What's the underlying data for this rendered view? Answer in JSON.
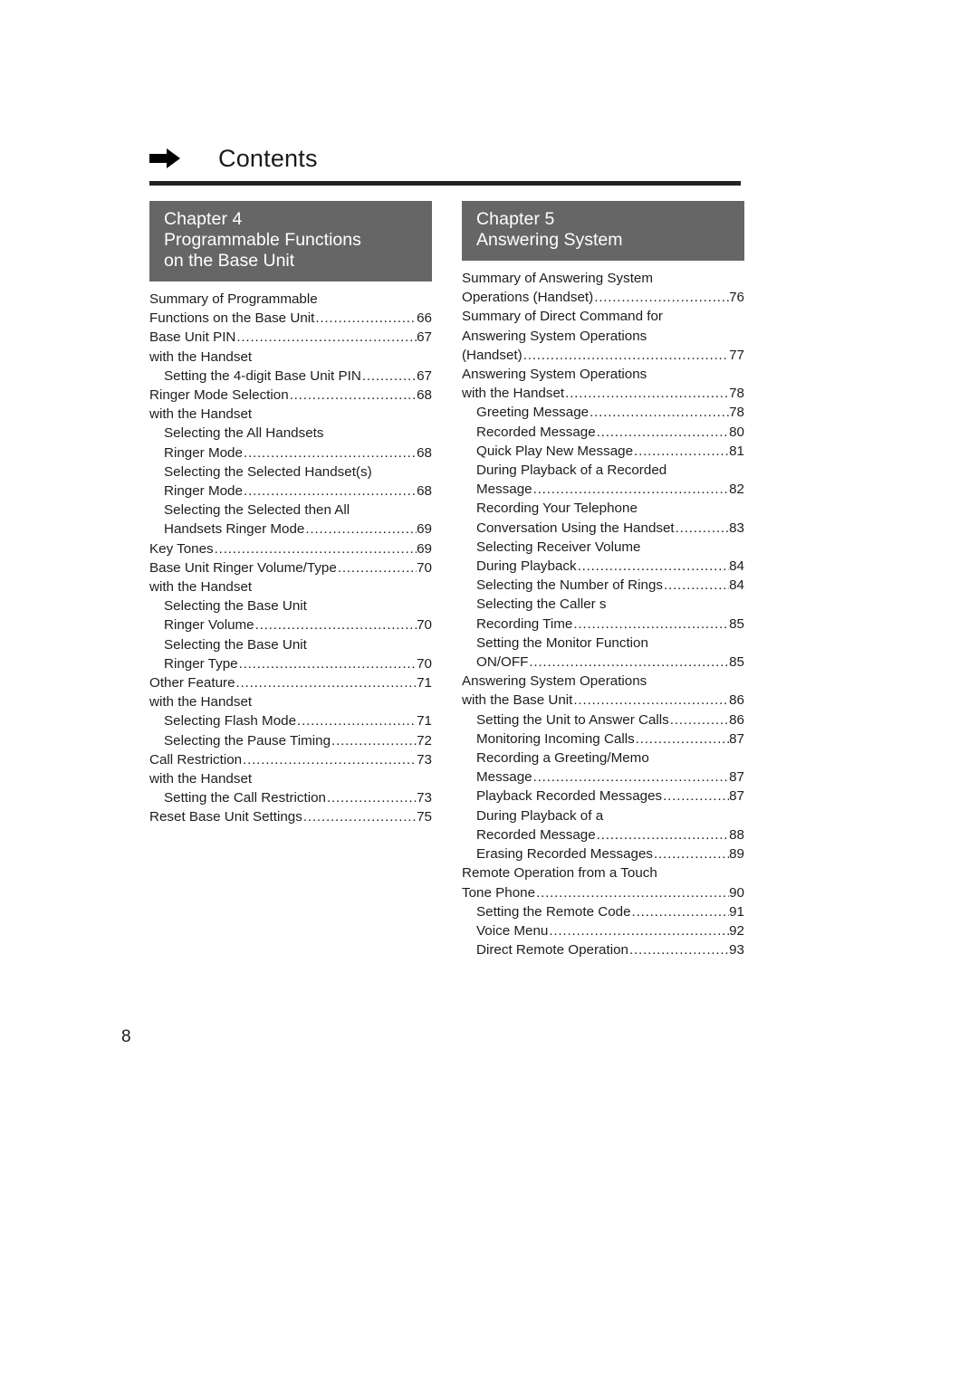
{
  "header": {
    "arrow_icon": "right-arrow-icon",
    "title": "Contents"
  },
  "folio": "8",
  "colors": {
    "banner_bg": "#666666",
    "banner_text": "#ffffff",
    "rule": "#222222",
    "body_text": "#1d1d1d"
  },
  "columns": [
    {
      "banner": {
        "chapter_label": "Chapter",
        "chapter_number": "4",
        "title_line_1": "Programmable Functions",
        "title_line_2": "on the Base Unit"
      },
      "entries": [
        {
          "level": 1,
          "text": "Summary of Programmable",
          "page": "",
          "dots": false
        },
        {
          "level": 1,
          "text": "Functions on the Base Unit",
          "page": "66",
          "dots": true
        },
        {
          "level": 1,
          "text": "Base Unit PIN",
          "page": "67",
          "dots": true
        },
        {
          "level": 1,
          "text": "with the Handset",
          "page": "",
          "dots": false
        },
        {
          "level": 2,
          "text": "Setting the 4-digit Base Unit PIN",
          "page": "67",
          "dots": true
        },
        {
          "level": 1,
          "text": "Ringer Mode Selection",
          "page": "68",
          "dots": true
        },
        {
          "level": 1,
          "text": "with the Handset",
          "page": "",
          "dots": false
        },
        {
          "level": 2,
          "text": "Selecting the  All Handsets",
          "page": "",
          "dots": false
        },
        {
          "level": 2,
          "text": "Ringer Mode",
          "page": "68",
          "dots": true
        },
        {
          "level": 2,
          "text": "Selecting the  Selected Handset(s)",
          "page": "",
          "dots": false
        },
        {
          "level": 2,
          "text": "Ringer Mode",
          "page": "68",
          "dots": true
        },
        {
          "level": 2,
          "text": "Selecting the  Selected then All",
          "page": "",
          "dots": false
        },
        {
          "level": 2,
          "text": "Handsets  Ringer Mode",
          "page": "69",
          "dots": true
        },
        {
          "level": 1,
          "text": "Key Tones",
          "page": "69",
          "dots": true
        },
        {
          "level": 1,
          "text": "Base Unit Ringer Volume/Type",
          "page": "70",
          "dots": true
        },
        {
          "level": 1,
          "text": "with the Handset",
          "page": "",
          "dots": false
        },
        {
          "level": 2,
          "text": "Selecting the Base Unit",
          "page": "",
          "dots": false
        },
        {
          "level": 2,
          "text": "Ringer Volume",
          "page": "70",
          "dots": true
        },
        {
          "level": 2,
          "text": "Selecting the Base Unit",
          "page": "",
          "dots": false
        },
        {
          "level": 2,
          "text": "Ringer Type",
          "page": "70",
          "dots": true
        },
        {
          "level": 1,
          "text": "Other Feature",
          "page": "71",
          "dots": true
        },
        {
          "level": 1,
          "text": "with the Handset",
          "page": "",
          "dots": false
        },
        {
          "level": 2,
          "text": "Selecting Flash Mode",
          "page": "71",
          "dots": true
        },
        {
          "level": 2,
          "text": "Selecting the Pause Timing",
          "page": "72",
          "dots": true
        },
        {
          "level": 1,
          "text": "Call Restriction",
          "page": "73",
          "dots": true
        },
        {
          "level": 1,
          "text": "with the Handset",
          "page": "",
          "dots": false
        },
        {
          "level": 2,
          "text": "Setting the Call Restriction",
          "page": "73",
          "dots": true
        },
        {
          "level": 1,
          "text": "Reset Base Unit Settings",
          "page": "75",
          "dots": true
        }
      ]
    },
    {
      "banner": {
        "chapter_label": "Chapter",
        "chapter_number": "5",
        "title_line_1": "Answering System",
        "title_line_2": ""
      },
      "entries": [
        {
          "level": 1,
          "text": "Summary of Answering System",
          "page": "",
          "dots": false
        },
        {
          "level": 1,
          "text": "Operations (Handset)",
          "page": "76",
          "dots": true
        },
        {
          "level": 1,
          "text": "Summary of Direct Command for",
          "page": "",
          "dots": false
        },
        {
          "level": 1,
          "text": "Answering System Operations",
          "page": "",
          "dots": false
        },
        {
          "level": 1,
          "text": "(Handset)",
          "page": "77",
          "dots": true
        },
        {
          "level": 1,
          "text": "Answering System Operations",
          "page": "",
          "dots": false
        },
        {
          "level": 1,
          "text": "with the Handset",
          "page": "78",
          "dots": true
        },
        {
          "level": 2,
          "text": "Greeting Message",
          "page": "78",
          "dots": true
        },
        {
          "level": 2,
          "text": "Recorded Message",
          "page": "80",
          "dots": true
        },
        {
          "level": 2,
          "text": "Quick Play New Message",
          "page": "81",
          "dots": true
        },
        {
          "level": 2,
          "text": "During Playback of a Recorded",
          "page": "",
          "dots": false
        },
        {
          "level": 2,
          "text": "Message",
          "page": "82",
          "dots": true
        },
        {
          "level": 2,
          "text": "Recording Your Telephone",
          "page": "",
          "dots": false
        },
        {
          "level": 2,
          "text": "Conversation Using the Handset",
          "page": "83",
          "dots": true
        },
        {
          "level": 2,
          "text": "Selecting Receiver Volume",
          "page": "",
          "dots": false
        },
        {
          "level": 2,
          "text": "During Playback",
          "page": "84",
          "dots": true
        },
        {
          "level": 2,
          "text": "Selecting the Number of Rings",
          "page": "84",
          "dots": true
        },
        {
          "level": 2,
          "text": "Selecting the Caller s",
          "page": "",
          "dots": false
        },
        {
          "level": 2,
          "text": "Recording Time",
          "page": "85",
          "dots": true
        },
        {
          "level": 2,
          "text": "Setting the Monitor Function",
          "page": "",
          "dots": false
        },
        {
          "level": 2,
          "text": "ON/OFF",
          "page": "85",
          "dots": true
        },
        {
          "level": 1,
          "text": "Answering System Operations",
          "page": "",
          "dots": false
        },
        {
          "level": 1,
          "text": "with the Base Unit",
          "page": "86",
          "dots": true
        },
        {
          "level": 2,
          "text": "Setting the Unit to Answer Calls",
          "page": "86",
          "dots": true
        },
        {
          "level": 2,
          "text": "Monitoring Incoming Calls",
          "page": "87",
          "dots": true
        },
        {
          "level": 2,
          "text": "Recording a Greeting/Memo",
          "page": "",
          "dots": false
        },
        {
          "level": 2,
          "text": "Message",
          "page": "87",
          "dots": true
        },
        {
          "level": 2,
          "text": "Playback Recorded Messages",
          "page": "87",
          "dots": true
        },
        {
          "level": 2,
          "text": "During Playback of a",
          "page": "",
          "dots": false
        },
        {
          "level": 2,
          "text": "Recorded Message",
          "page": "88",
          "dots": true
        },
        {
          "level": 2,
          "text": "Erasing Recorded Messages",
          "page": "89",
          "dots": true
        },
        {
          "level": 1,
          "text": "Remote Operation from a Touch",
          "page": "",
          "dots": false
        },
        {
          "level": 1,
          "text": "Tone Phone",
          "page": "90",
          "dots": true
        },
        {
          "level": 2,
          "text": "Setting the Remote Code",
          "page": "91",
          "dots": true
        },
        {
          "level": 2,
          "text": "Voice Menu",
          "page": "92",
          "dots": true
        },
        {
          "level": 2,
          "text": "Direct Remote Operation",
          "page": "93",
          "dots": true
        }
      ]
    }
  ]
}
